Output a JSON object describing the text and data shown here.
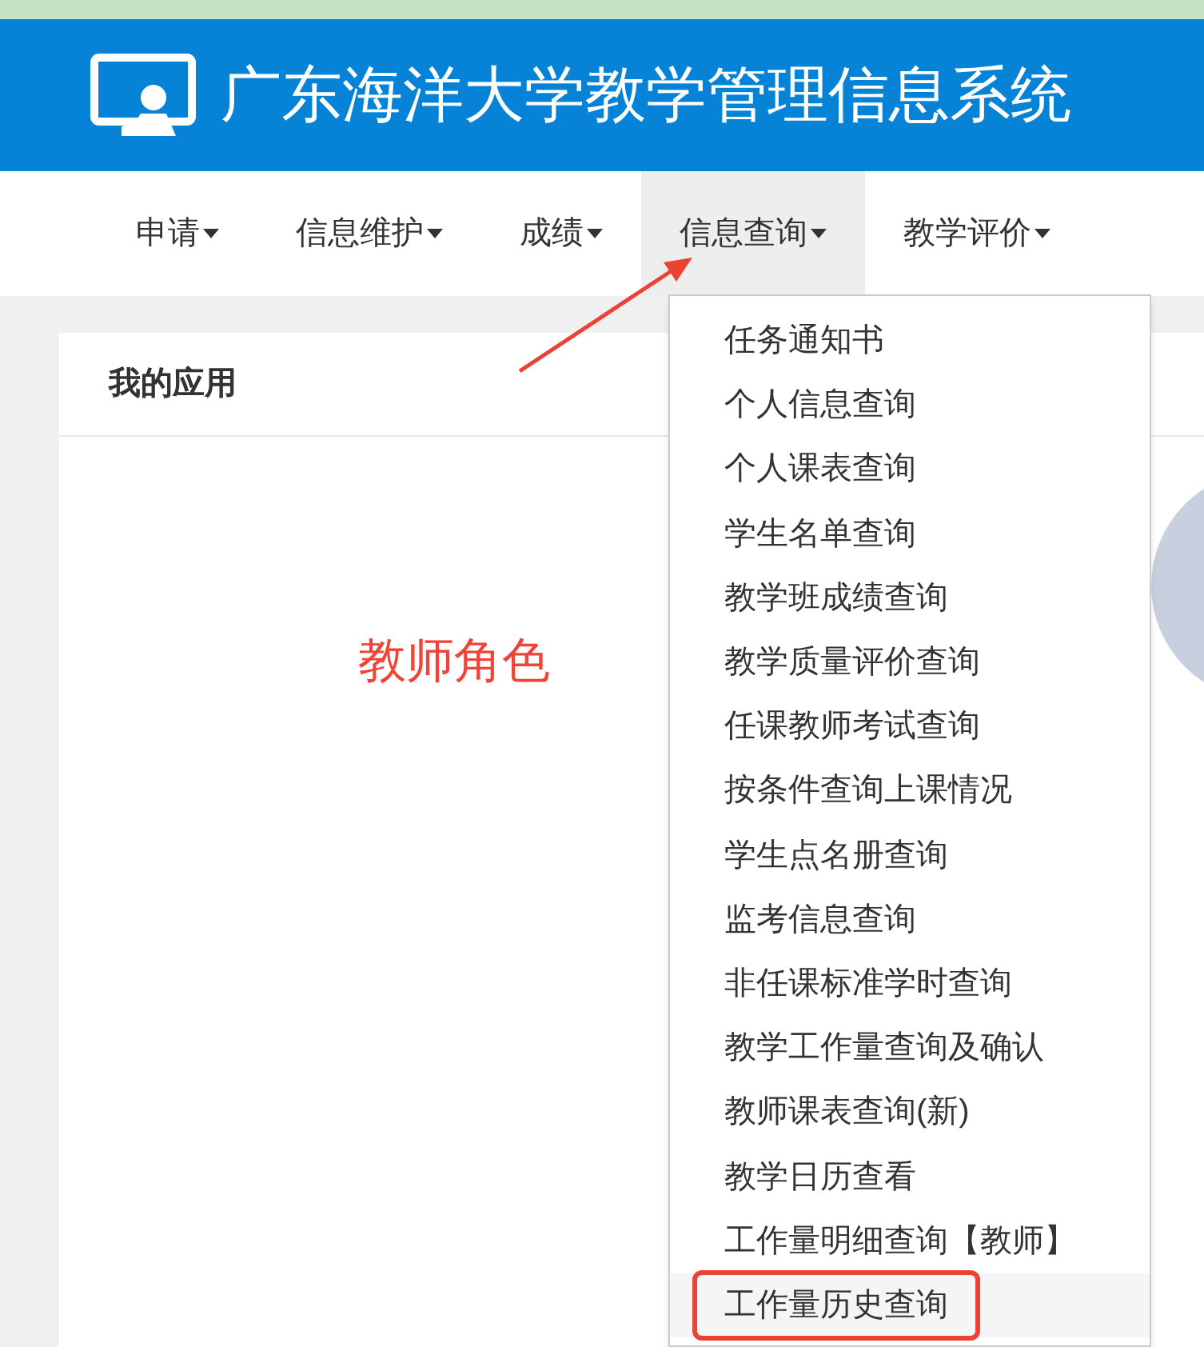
{
  "header": {
    "title": "广东海洋大学教学管理信息系统"
  },
  "nav": [
    {
      "label": "申请",
      "selected": false
    },
    {
      "label": "信息维护",
      "selected": false
    },
    {
      "label": "成绩",
      "selected": false
    },
    {
      "label": "信息查询",
      "selected": true
    },
    {
      "label": "教学评价",
      "selected": false
    }
  ],
  "dropdown": {
    "items": [
      {
        "label": "任务通知书",
        "highlighted": false
      },
      {
        "label": "个人信息查询",
        "highlighted": false
      },
      {
        "label": "个人课表查询",
        "highlighted": false
      },
      {
        "label": "学生名单查询",
        "highlighted": false
      },
      {
        "label": "教学班成绩查询",
        "highlighted": false
      },
      {
        "label": "教学质量评价查询",
        "highlighted": false
      },
      {
        "label": "任课教师考试查询",
        "highlighted": false
      },
      {
        "label": "按条件查询上课情况",
        "highlighted": false
      },
      {
        "label": "学生点名册查询",
        "highlighted": false
      },
      {
        "label": "监考信息查询",
        "highlighted": false
      },
      {
        "label": "非任课标准学时查询",
        "highlighted": false
      },
      {
        "label": "教学工作量查询及确认",
        "highlighted": false
      },
      {
        "label": "教师课表查询(新)",
        "highlighted": false
      },
      {
        "label": "教学日历查看",
        "highlighted": false
      },
      {
        "label": "工作量明细查询【教师】",
        "highlighted": false
      },
      {
        "label": "工作量历史查询",
        "highlighted": true
      }
    ]
  },
  "panel": {
    "title": "我的应用"
  },
  "annotation": {
    "label": "教师角色"
  }
}
